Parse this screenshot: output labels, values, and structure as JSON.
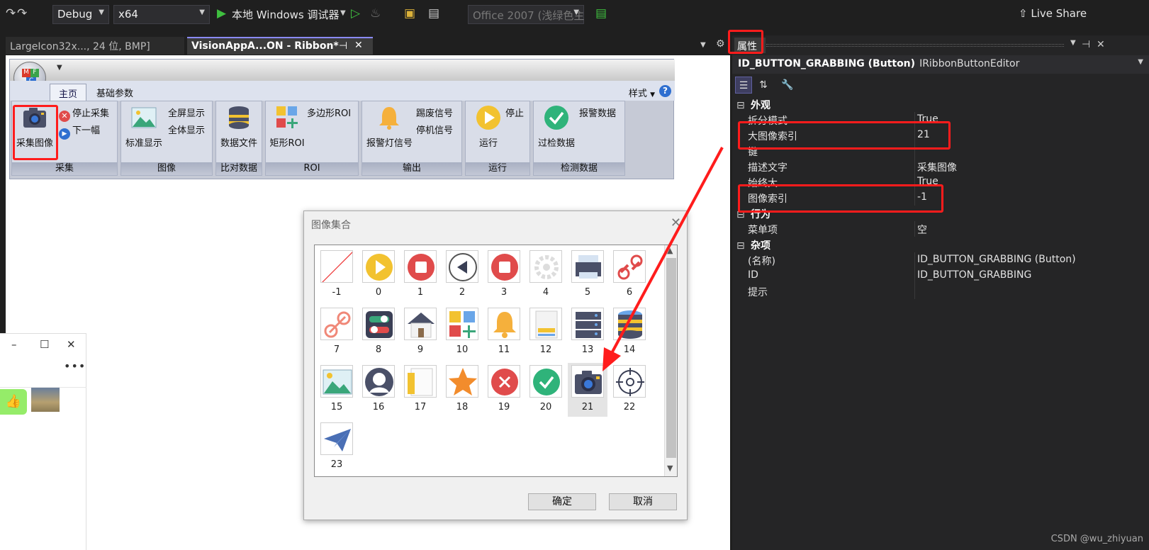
{
  "toolbar": {
    "config": "Debug",
    "platform": "x64",
    "debugger": "本地 Windows 调试器",
    "theme": "Office 2007 (浅绿色主",
    "live_share": "Live Share"
  },
  "doc_tabs": [
    {
      "label": "LargeIcon32x..., 24 位, BMP]"
    },
    {
      "label": "VisionAppA...ON - Ribbon*"
    }
  ],
  "ribbon": {
    "tabs": [
      "主页",
      "基础参数"
    ],
    "style_menu": "样式",
    "help": "?",
    "groups": [
      {
        "label": "采集",
        "big": "采集图像",
        "small": [
          "停止采集",
          "下一幅"
        ]
      },
      {
        "label": "图像",
        "big": "标准显示",
        "small": [
          "全屏显示",
          "全体显示"
        ]
      },
      {
        "label": "比对数据",
        "big": "数据文件"
      },
      {
        "label": "ROI",
        "big": "矩形ROI",
        "small": [
          "多边形ROI"
        ]
      },
      {
        "label": "输出",
        "big": "报警灯信号",
        "small": [
          "踢废信号",
          "停机信号"
        ]
      },
      {
        "label": "运行",
        "big": "运行",
        "small": [
          "停止"
        ]
      },
      {
        "label": "检测数据",
        "big": "过检数据",
        "small": [
          "报警数据"
        ]
      }
    ]
  },
  "dialog": {
    "title": "图像集合",
    "ok": "确定",
    "cancel": "取消",
    "items": [
      "-1",
      "0",
      "1",
      "2",
      "3",
      "4",
      "5",
      "6",
      "7",
      "8",
      "9",
      "10",
      "11",
      "12",
      "13",
      "14",
      "15",
      "16",
      "17",
      "18",
      "19",
      "20",
      "21",
      "22",
      "23"
    ],
    "selected": "21"
  },
  "props": {
    "tab": "属性",
    "object_name": "ID_BUTTON_GRABBING (Button)",
    "object_type": "IRibbonButtonEditor",
    "categories": {
      "appearance": "外观",
      "behavior": "行为",
      "misc": "杂项"
    },
    "rows": {
      "split_mode": {
        "name": "拆分模式",
        "value": "True"
      },
      "large_image_index": {
        "name": "大图像索引",
        "value": "21"
      },
      "key": {
        "name": "键",
        "value": ""
      },
      "description": {
        "name": "描述文字",
        "value": "采集图像"
      },
      "always_large": {
        "name": "始终大",
        "value": "True"
      },
      "image_index": {
        "name": "图像索引",
        "value": "-1"
      },
      "menu_items": {
        "name": "菜单项",
        "value": "空"
      },
      "name": {
        "name": "(名称)",
        "value": "ID_BUTTON_GRABBING (Button)"
      },
      "id": {
        "name": "ID",
        "value": "ID_BUTTON_GRABBING"
      },
      "tooltip": {
        "name": "提示",
        "value": ""
      }
    }
  },
  "watermark": "CSDN @wu_zhiyuan",
  "colors": {
    "highlight": "#ff1c1c",
    "accent": "#2f6fd0"
  }
}
